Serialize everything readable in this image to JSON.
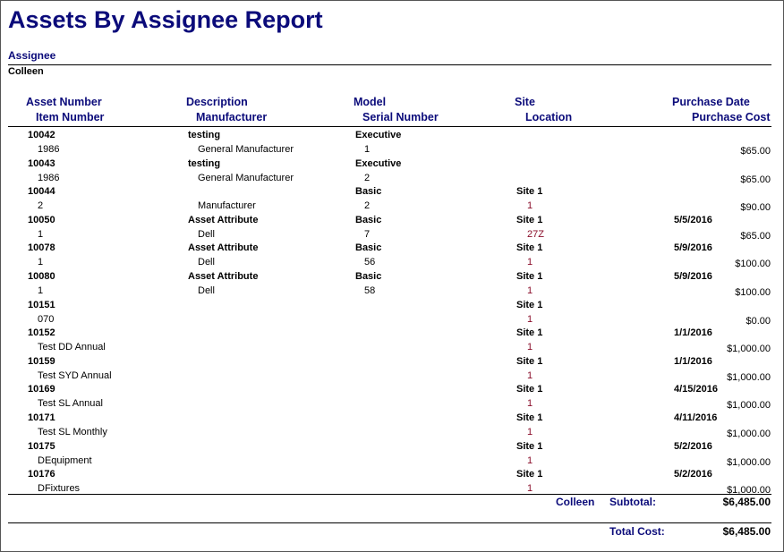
{
  "report_title": "Assets By Assignee Report",
  "group_label": "Assignee",
  "assignee_name": "Colleen",
  "headers": {
    "asset_number": "Asset Number",
    "item_number": "Item Number",
    "description": "Description",
    "manufacturer": "Manufacturer",
    "model": "Model",
    "serial_number": "Serial Number",
    "site": "Site",
    "location": "Location",
    "purchase_date": "Purchase Date",
    "purchase_cost": "Purchase Cost"
  },
  "records": [
    {
      "asset_number": "10042",
      "description": "testing",
      "model": "Executive",
      "site": "",
      "purchase_date": "",
      "item_number": "1986",
      "manufacturer": "General Manufacturer",
      "serial_number": "1",
      "location": "",
      "purchase_cost": "$65.00"
    },
    {
      "asset_number": "10043",
      "description": "testing",
      "model": "Executive",
      "site": "",
      "purchase_date": "",
      "item_number": "1986",
      "manufacturer": "General Manufacturer",
      "serial_number": "2",
      "location": "",
      "purchase_cost": "$65.00"
    },
    {
      "asset_number": "10044",
      "description": "",
      "model": "Basic",
      "site": "Site 1",
      "purchase_date": "",
      "item_number": "2",
      "manufacturer": "Manufacturer",
      "serial_number": "2",
      "location": "1",
      "purchase_cost": "$90.00"
    },
    {
      "asset_number": "10050",
      "description": "Asset Attribute",
      "model": "Basic",
      "site": "Site 1",
      "purchase_date": "5/5/2016",
      "item_number": "1",
      "manufacturer": "Dell",
      "serial_number": "7",
      "location": "27Z",
      "purchase_cost": "$65.00"
    },
    {
      "asset_number": "10078",
      "description": "Asset Attribute",
      "model": "Basic",
      "site": "Site 1",
      "purchase_date": "5/9/2016",
      "item_number": "1",
      "manufacturer": "Dell",
      "serial_number": "56",
      "location": "1",
      "purchase_cost": "$100.00"
    },
    {
      "asset_number": "10080",
      "description": "Asset Attribute",
      "model": "Basic",
      "site": "Site 1",
      "purchase_date": "5/9/2016",
      "item_number": "1",
      "manufacturer": "Dell",
      "serial_number": "58",
      "location": "1",
      "purchase_cost": "$100.00"
    },
    {
      "asset_number": "10151",
      "description": "",
      "model": "",
      "site": "Site 1",
      "purchase_date": "",
      "item_number": "070",
      "manufacturer": "",
      "serial_number": "",
      "location": "1",
      "purchase_cost": "$0.00"
    },
    {
      "asset_number": "10152",
      "description": "",
      "model": "",
      "site": "Site 1",
      "purchase_date": "1/1/2016",
      "item_number": "Test DD Annual",
      "manufacturer": "",
      "serial_number": "",
      "location": "1",
      "purchase_cost": "$1,000.00"
    },
    {
      "asset_number": "10159",
      "description": "",
      "model": "",
      "site": "Site 1",
      "purchase_date": "1/1/2016",
      "item_number": "Test SYD Annual",
      "manufacturer": "",
      "serial_number": "",
      "location": "1",
      "purchase_cost": "$1,000.00"
    },
    {
      "asset_number": "10169",
      "description": "",
      "model": "",
      "site": "Site 1",
      "purchase_date": "4/15/2016",
      "item_number": "Test SL Annual",
      "manufacturer": "",
      "serial_number": "",
      "location": "1",
      "purchase_cost": "$1,000.00"
    },
    {
      "asset_number": "10171",
      "description": "",
      "model": "",
      "site": "Site 1",
      "purchase_date": "4/11/2016",
      "item_number": "Test SL Monthly",
      "manufacturer": "",
      "serial_number": "",
      "location": "1",
      "purchase_cost": "$1,000.00"
    },
    {
      "asset_number": "10175",
      "description": "",
      "model": "",
      "site": "Site 1",
      "purchase_date": "5/2/2016",
      "item_number": "DEquipment",
      "manufacturer": "",
      "serial_number": "",
      "location": "1",
      "purchase_cost": "$1,000.00"
    },
    {
      "asset_number": "10176",
      "description": "",
      "model": "",
      "site": "Site 1",
      "purchase_date": "5/2/2016",
      "item_number": "DFixtures",
      "manufacturer": "",
      "serial_number": "",
      "location": "1",
      "purchase_cost": "$1,000.00"
    }
  ],
  "subtotal": {
    "name": "Colleen",
    "label": "Subtotal:",
    "value": "$6,485.00"
  },
  "total": {
    "label": "Total Cost:",
    "value": "$6,485.00"
  },
  "colors": {
    "heading_blue": "#0b0b7a",
    "red_value": "#8a0d2a"
  }
}
